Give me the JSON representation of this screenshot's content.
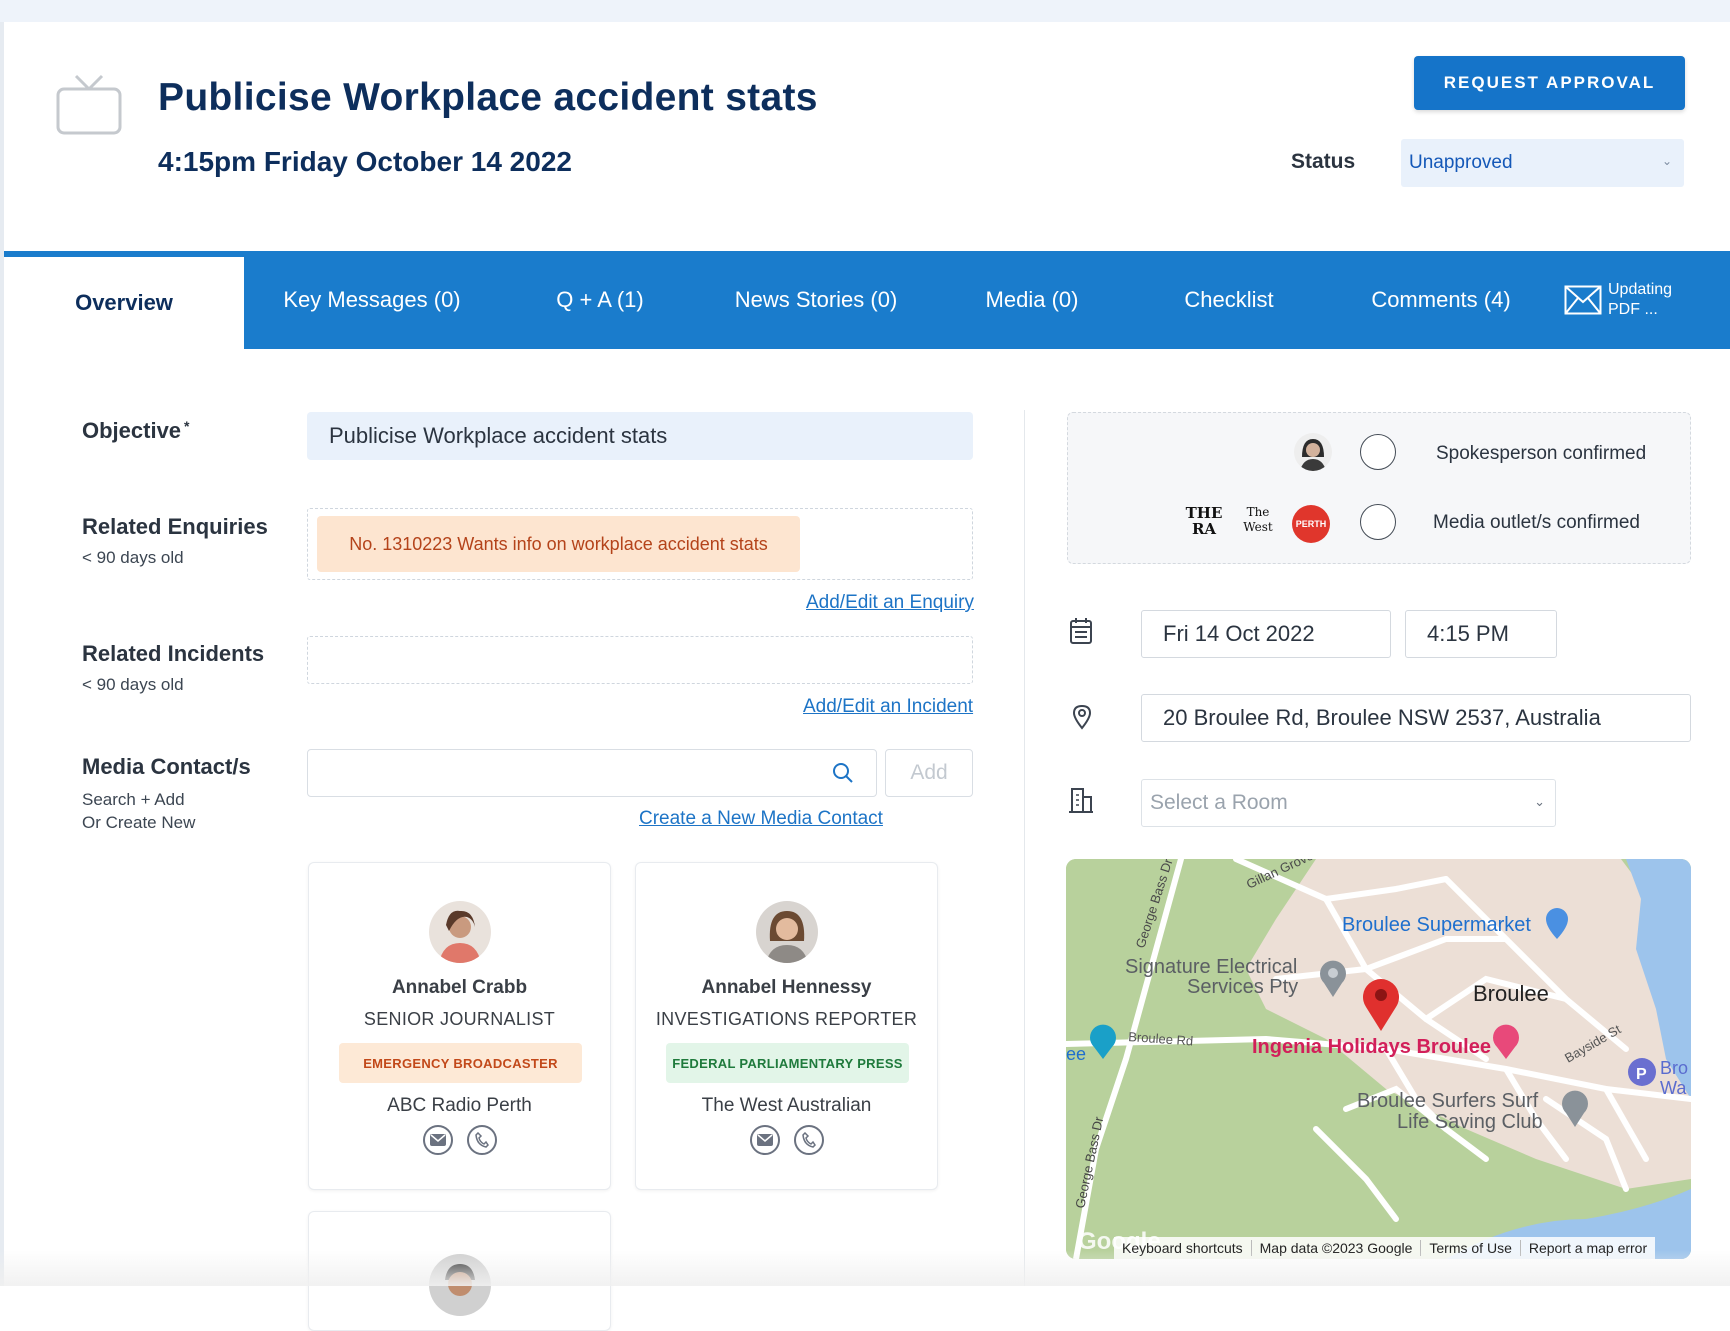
{
  "header": {
    "title": "Publicise Workplace accident stats",
    "datetime": "4:15pm Friday October 14 2022",
    "request_button": "REQUEST APPROVAL",
    "status_label": "Status",
    "status_value": "Unapproved"
  },
  "tabs": [
    {
      "label": "Overview"
    },
    {
      "label": "Key Messages (0)"
    },
    {
      "label": "Q + A (1)"
    },
    {
      "label": "News Stories (0)"
    },
    {
      "label": "Media (0)"
    },
    {
      "label": "Checklist"
    },
    {
      "label": "Comments (4)"
    }
  ],
  "pdf": {
    "line1": "Updating",
    "line2": "PDF ..."
  },
  "form": {
    "objective_label": "Objective",
    "objective_required": "*",
    "objective_value": "Publicise Workplace accident stats",
    "enquiries_label": "Related Enquiries",
    "enquiries_sub": "< 90 days old",
    "enquiry_chip": "No. 1310223 Wants info on workplace accident stats",
    "enquiry_link": "Add/Edit an Enquiry",
    "incidents_label": "Related Incidents",
    "incidents_sub": "< 90 days old",
    "incident_link": "Add/Edit an Incident",
    "contacts_label": "Media Contact/s",
    "contacts_sub1": "Search + Add",
    "contacts_sub2": "Or Create New",
    "add_button": "Add",
    "create_link": "Create a New Media Contact"
  },
  "contacts": [
    {
      "name": "Annabel Crabb",
      "role": "SENIOR JOURNALIST",
      "tag": "EMERGENCY BROADCASTER",
      "outlet": "ABC Radio Perth"
    },
    {
      "name": "Annabel Hennessy",
      "role": "INVESTIGATIONS REPORTER",
      "tag": "FEDERAL PARLIAMENTARY PRESS",
      "outlet": "The West Australian"
    }
  ],
  "confirm": {
    "spokesperson": "Spokesperson confirmed",
    "media_outlets": "Media outlet/s confirmed",
    "logo1_text": "THE RA",
    "logo2_text": "The West",
    "logo3_text": "PERTH"
  },
  "schedule": {
    "date": "Fri 14 Oct 2022",
    "time": "4:15 PM",
    "address": "20 Broulee Rd, Broulee NSW 2537, Australia",
    "room_placeholder": "Select a Room"
  },
  "map": {
    "labels": {
      "gillan": "Gillan Grove",
      "george": "George Bass Dr",
      "supermarket": "Broulee Supermarket",
      "signature1": "Signature Electrical",
      "signature2": "Services Pty",
      "broulee": "Broulee",
      "broulee_rd": "Broulee Rd",
      "ingenia": "Ingenia Holidays Broulee",
      "bayside": "Bayside St",
      "surf1": "Broulee Surfers Surf",
      "surf2": "Life Saving Club",
      "bass_dr": "George Bass Dr",
      "edge_ee": "ee",
      "edge_bro": "Bro",
      "edge_wa": "Wa",
      "google": "Google"
    },
    "footer": [
      "Keyboard shortcuts",
      "Map data ©2023 Google",
      "Terms of Use",
      "Report a map error"
    ]
  }
}
